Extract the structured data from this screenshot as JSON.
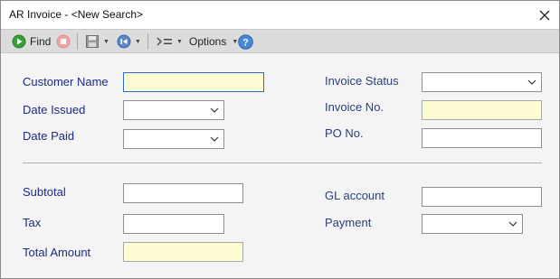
{
  "window": {
    "title": "AR Invoice - <New Search>"
  },
  "toolbar": {
    "find_label": "Find",
    "options_label": "Options",
    "icons": [
      "find-icon",
      "stop-icon",
      "save-icon",
      "back-icon",
      "indent-icon",
      "help-icon"
    ]
  },
  "form": {
    "customer_name": {
      "label": "Customer Name",
      "value": ""
    },
    "date_issued": {
      "label": "Date Issued",
      "value": ""
    },
    "date_paid": {
      "label": "Date Paid",
      "value": ""
    },
    "invoice_status": {
      "label": "Invoice Status",
      "value": ""
    },
    "invoice_no": {
      "label": "Invoice No.",
      "value": ""
    },
    "po_no": {
      "label": "PO No.",
      "value": ""
    },
    "subtotal": {
      "label": "Subtotal",
      "value": ""
    },
    "tax": {
      "label": "Tax",
      "value": ""
    },
    "total_amount": {
      "label": "Total Amount",
      "value": ""
    },
    "gl_account": {
      "label": "GL account",
      "value": ""
    },
    "payment": {
      "label": "Payment",
      "value": ""
    }
  },
  "colors": {
    "label_blue": "#1f2a86",
    "required_field_yellow": "#fdfcd2",
    "toolbar_gray": "#dcdcdc",
    "focus_blue": "#2c6cc8"
  }
}
